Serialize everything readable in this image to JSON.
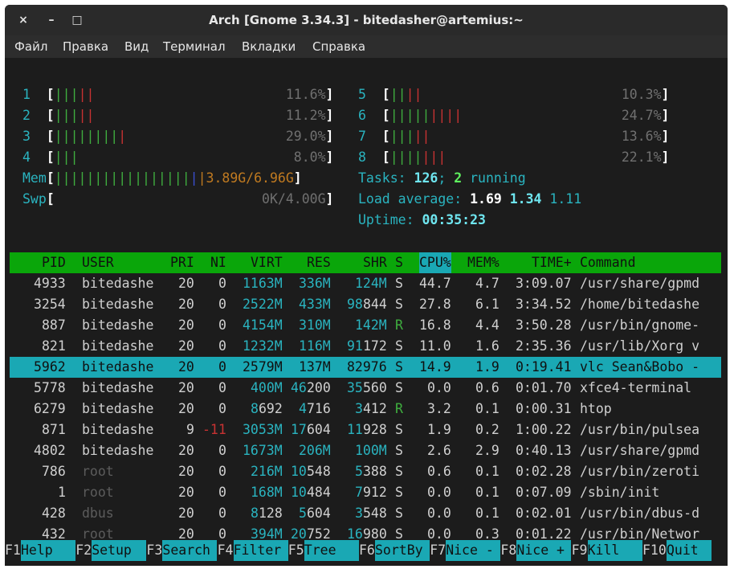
{
  "window": {
    "title": "Arch [Gnome 3.34.3] - bitedasher@artemius:~",
    "close": "×",
    "minimize": "–",
    "maximize": "□"
  },
  "menu": [
    "Файл",
    "Правка",
    "Вид",
    "Терминал",
    "Вкладки",
    "Справка"
  ],
  "cpus": [
    {
      "id": "1",
      "pct": "11.6%",
      "g": "|||",
      "r": "||"
    },
    {
      "id": "2",
      "pct": "11.2%",
      "g": "|||",
      "r": "||"
    },
    {
      "id": "3",
      "pct": "29.0%",
      "g": "||||||||",
      "r": "|"
    },
    {
      "id": "4",
      "pct": "8.0%",
      "g": "|||",
      "r": ""
    },
    {
      "id": "5",
      "pct": "10.3%",
      "g": "||",
      "r": "||"
    },
    {
      "id": "6",
      "pct": "24.7%",
      "g": "|||||",
      "r": "||||"
    },
    {
      "id": "7",
      "pct": "13.6%",
      "g": "|||",
      "r": "||"
    },
    {
      "id": "8",
      "pct": "22.1%",
      "g": "||||",
      "r": "|||"
    }
  ],
  "mem": {
    "label": "Mem",
    "bars": "|||||||||||||||||",
    "blue": "|",
    "value": "3.89G/6.96G"
  },
  "swp": {
    "label": "Swp",
    "value": "0K/4.00G"
  },
  "tasks": {
    "label": "Tasks:",
    "count": "126",
    "sep": ";",
    "running": "2",
    "running_label": "running"
  },
  "load": {
    "label": "Load average:",
    "v1": "1.69",
    "v2": "1.34",
    "v3": "1.11"
  },
  "uptime": {
    "label": "Uptime:",
    "value": "00:35:23"
  },
  "header": {
    "pid": "PID",
    "user": "USER",
    "pri": "PRI",
    "ni": "NI",
    "virt": "VIRT",
    "res": "RES",
    "shr": "SHR",
    "s": "S",
    "cpu": "CPU%",
    "mem": "MEM%",
    "time": "TIME+",
    "cmd": "Command"
  },
  "processes": [
    {
      "pid": "4933",
      "user": "bitedashe",
      "pri": "20",
      "ni": "0",
      "virt": "1163M",
      "res": "336M",
      "shr": "124M",
      "s": "S",
      "cpu": "44.7",
      "mem": "4.7",
      "time": "3:09.07",
      "cmd": "/usr/share/gpmd"
    },
    {
      "pid": "3254",
      "user": "bitedashe",
      "pri": "20",
      "ni": "0",
      "virt": "2522M",
      "res": "433M",
      "shr": "98844",
      "s": "S",
      "cpu": "27.8",
      "mem": "6.1",
      "time": "3:34.52",
      "cmd": "/home/bitedashe"
    },
    {
      "pid": "887",
      "user": "bitedashe",
      "pri": "20",
      "ni": "0",
      "virt": "4154M",
      "res": "310M",
      "shr": "142M",
      "s": "R",
      "cpu": "16.8",
      "mem": "4.4",
      "time": "3:50.28",
      "cmd": "/usr/bin/gnome-"
    },
    {
      "pid": "821",
      "user": "bitedashe",
      "pri": "20",
      "ni": "0",
      "virt": "1232M",
      "res": "116M",
      "shr": "91172",
      "s": "S",
      "cpu": "11.0",
      "mem": "1.6",
      "time": "2:35.36",
      "cmd": "/usr/lib/Xorg v"
    },
    {
      "pid": "5962",
      "user": "bitedashe",
      "pri": "20",
      "ni": "0",
      "virt": "2579M",
      "res": "137M",
      "shr": "82976",
      "s": "S",
      "cpu": "14.9",
      "mem": "1.9",
      "time": "0:19.41",
      "cmd": "vlc Sean&Bobo -"
    },
    {
      "pid": "5778",
      "user": "bitedashe",
      "pri": "20",
      "ni": "0",
      "virt": "400M",
      "res": "46200",
      "shr": "35560",
      "s": "S",
      "cpu": "0.0",
      "mem": "0.6",
      "time": "0:01.70",
      "cmd": "xfce4-terminal"
    },
    {
      "pid": "6279",
      "user": "bitedashe",
      "pri": "20",
      "ni": "0",
      "virt": "8692",
      "res": "4716",
      "shr": "3412",
      "s": "R",
      "cpu": "3.2",
      "mem": "0.1",
      "time": "0:00.31",
      "cmd": "htop"
    },
    {
      "pid": "871",
      "user": "bitedashe",
      "pri": "9",
      "ni": "-11",
      "virt": "3053M",
      "res": "17604",
      "shr": "11928",
      "s": "S",
      "cpu": "1.9",
      "mem": "0.2",
      "time": "1:00.22",
      "cmd": "/usr/bin/pulsea"
    },
    {
      "pid": "4802",
      "user": "bitedashe",
      "pri": "20",
      "ni": "0",
      "virt": "1673M",
      "res": "206M",
      "shr": "100M",
      "s": "S",
      "cpu": "2.6",
      "mem": "2.9",
      "time": "0:40.13",
      "cmd": "/usr/share/gpmd"
    },
    {
      "pid": "786",
      "user": "root",
      "pri": "20",
      "ni": "0",
      "virt": "216M",
      "res": "10548",
      "shr": "5388",
      "s": "S",
      "cpu": "0.6",
      "mem": "0.1",
      "time": "0:02.28",
      "cmd": "/usr/bin/zeroti"
    },
    {
      "pid": "1",
      "user": "root",
      "pri": "20",
      "ni": "0",
      "virt": "168M",
      "res": "10484",
      "shr": "7912",
      "s": "S",
      "cpu": "0.0",
      "mem": "0.1",
      "time": "0:07.09",
      "cmd": "/sbin/init"
    },
    {
      "pid": "428",
      "user": "dbus",
      "pri": "20",
      "ni": "0",
      "virt": "8128",
      "res": "5604",
      "shr": "3548",
      "s": "S",
      "cpu": "0.0",
      "mem": "0.1",
      "time": "0:02.01",
      "cmd": "/usr/bin/dbus-d"
    },
    {
      "pid": "432",
      "user": "root",
      "pri": "20",
      "ni": "0",
      "virt": "394M",
      "res": "20752",
      "shr": "16980",
      "s": "S",
      "cpu": "0.0",
      "mem": "0.3",
      "time": "0:01.22",
      "cmd": "/usr/bin/Networ"
    }
  ],
  "fkeys": [
    {
      "key": "F1",
      "label": "Help"
    },
    {
      "key": "F2",
      "label": "Setup"
    },
    {
      "key": "F3",
      "label": "Search"
    },
    {
      "key": "F4",
      "label": "Filter"
    },
    {
      "key": "F5",
      "label": "Tree"
    },
    {
      "key": "F6",
      "label": "SortBy"
    },
    {
      "key": "F7",
      "label": "Nice -"
    },
    {
      "key": "F8",
      "label": "Nice +"
    },
    {
      "key": "F9",
      "label": "Kill"
    },
    {
      "key": "F10",
      "label": "Quit"
    }
  ]
}
